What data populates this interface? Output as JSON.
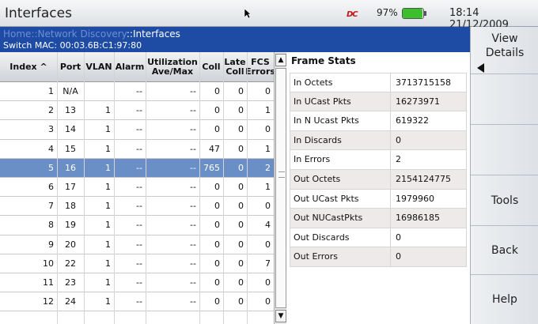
{
  "status": {
    "title": "Interfaces",
    "battery_pct": "97%",
    "battery_level": 0.97,
    "clock": "18:14 21/12/2009",
    "power_icon_text": "DC"
  },
  "header": {
    "crumb_1": "Home",
    "crumb_sep_1": "::",
    "crumb_2": "Network Discovery",
    "crumb_current": "::Interfaces",
    "switch_mac": "Switch MAC: 00:03.6B:C1:97:80"
  },
  "table": {
    "columns": {
      "index": "Index ^",
      "port": "Port",
      "vlan": "VLAN",
      "alarm": "Alarm",
      "util": "Utilization Ave/Max",
      "coll": "Coll",
      "late": "Late Coll",
      "fcs": "FCS Errors"
    },
    "rows": [
      {
        "index": "1",
        "port": "N/A",
        "vlan": "",
        "alarm": "--",
        "util": "--",
        "coll": "0",
        "late": "0",
        "fcs": "0"
      },
      {
        "index": "2",
        "port": "13",
        "vlan": "1",
        "alarm": "--",
        "util": "--",
        "coll": "0",
        "late": "0",
        "fcs": "1"
      },
      {
        "index": "3",
        "port": "14",
        "vlan": "1",
        "alarm": "--",
        "util": "--",
        "coll": "0",
        "late": "0",
        "fcs": "0"
      },
      {
        "index": "4",
        "port": "15",
        "vlan": "1",
        "alarm": "--",
        "util": "--",
        "coll": "47",
        "late": "0",
        "fcs": "1"
      },
      {
        "index": "5",
        "port": "16",
        "vlan": "1",
        "alarm": "--",
        "util": "--",
        "coll": "765",
        "late": "0",
        "fcs": "2"
      },
      {
        "index": "6",
        "port": "17",
        "vlan": "1",
        "alarm": "--",
        "util": "--",
        "coll": "0",
        "late": "0",
        "fcs": "1"
      },
      {
        "index": "7",
        "port": "18",
        "vlan": "1",
        "alarm": "--",
        "util": "--",
        "coll": "0",
        "late": "0",
        "fcs": "0"
      },
      {
        "index": "8",
        "port": "19",
        "vlan": "1",
        "alarm": "--",
        "util": "--",
        "coll": "0",
        "late": "0",
        "fcs": "4"
      },
      {
        "index": "9",
        "port": "20",
        "vlan": "1",
        "alarm": "--",
        "util": "--",
        "coll": "0",
        "late": "0",
        "fcs": "0"
      },
      {
        "index": "10",
        "port": "22",
        "vlan": "1",
        "alarm": "--",
        "util": "--",
        "coll": "0",
        "late": "0",
        "fcs": "7"
      },
      {
        "index": "11",
        "port": "23",
        "vlan": "1",
        "alarm": "--",
        "util": "--",
        "coll": "0",
        "late": "0",
        "fcs": "0"
      },
      {
        "index": "12",
        "port": "24",
        "vlan": "1",
        "alarm": "--",
        "util": "--",
        "coll": "0",
        "late": "0",
        "fcs": "0"
      }
    ],
    "selected_index": "5"
  },
  "frame_stats": {
    "title": "Frame Stats",
    "rows": [
      {
        "label": "In Octets",
        "value": "3713715158"
      },
      {
        "label": "In UCast Pkts",
        "value": "16273971"
      },
      {
        "label": "In N Ucast Pkts",
        "value": "619322"
      },
      {
        "label": "In Discards",
        "value": "0"
      },
      {
        "label": "In Errors",
        "value": "2"
      },
      {
        "label": "Out Octets",
        "value": "2154124775"
      },
      {
        "label": "Out UCast Pkts",
        "value": "1979960"
      },
      {
        "label": "Out NUCastPkts",
        "value": "16986185"
      },
      {
        "label": "Out Discards",
        "value": "0"
      },
      {
        "label": "Out Errors",
        "value": "0"
      }
    ]
  },
  "softkeys": {
    "view_details": "View Details",
    "tools": "Tools",
    "back": "Back",
    "help": "Help"
  },
  "colors": {
    "header_blue": "#1e4ba4",
    "selected_row": "#6a8fc6",
    "battery_green": "#3cbf2c"
  }
}
